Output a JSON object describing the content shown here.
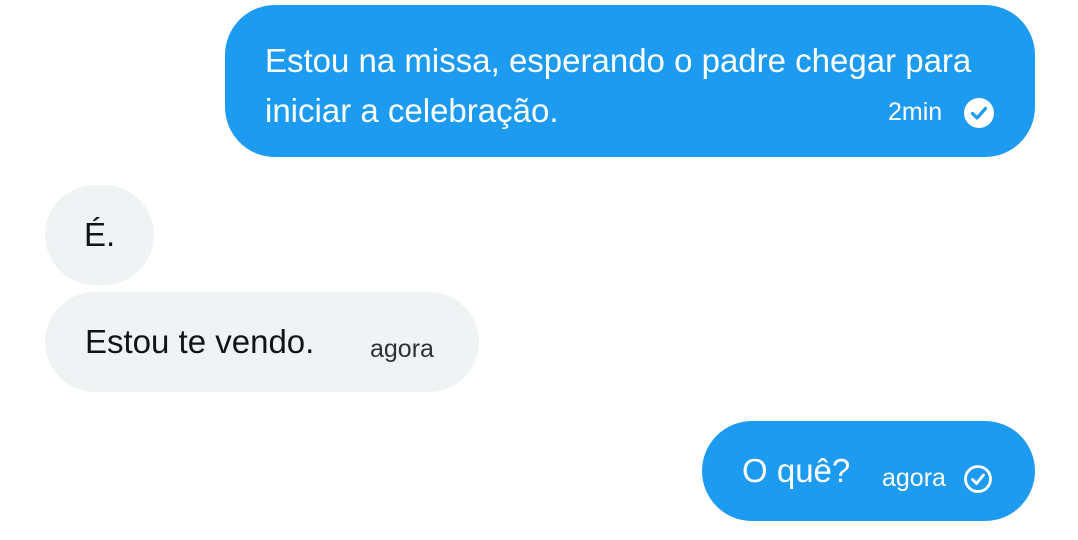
{
  "conversation": {
    "messages": [
      {
        "direction": "outgoing",
        "text": "Estou na missa, esperando o padre chegar para iniciar a celebração.",
        "time": "2min",
        "status_icon": "check-circle-filled-icon"
      },
      {
        "direction": "incoming",
        "text": "É.",
        "time": ""
      },
      {
        "direction": "incoming",
        "text": "Estou te vendo.",
        "time": "agora"
      },
      {
        "direction": "outgoing",
        "text": "O quê?",
        "time": "agora",
        "status_icon": "check-circle-outline-icon"
      }
    ]
  },
  "colors": {
    "outgoing_bubble": "#1d9bf0",
    "incoming_bubble": "#eff3f4",
    "incoming_text": "#0f1419",
    "outgoing_text": "#ffffff"
  }
}
